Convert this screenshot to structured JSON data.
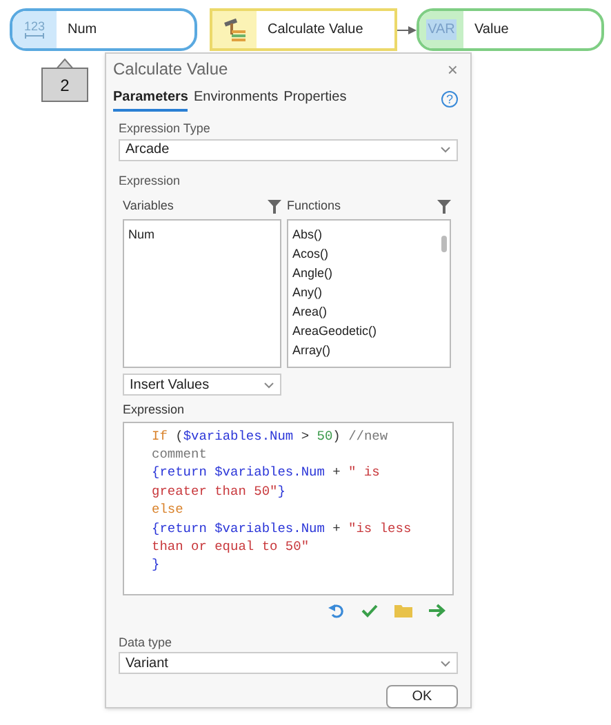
{
  "nodes": [
    {
      "kind": "variable",
      "icon_text": "123",
      "label": "Num"
    },
    {
      "kind": "tool",
      "label": "Calculate Value"
    },
    {
      "kind": "output",
      "icon_text": "VAR",
      "label": "Value"
    }
  ],
  "callout": "2",
  "dialog": {
    "title": "Calculate Value",
    "close": "×",
    "tabs": [
      {
        "label": "Parameters",
        "selected": true
      },
      {
        "label": "Environments",
        "selected": false
      },
      {
        "label": "Properties",
        "selected": false
      }
    ],
    "help": "?",
    "expression_type": {
      "label": "Expression Type",
      "value": "Arcade"
    },
    "expression_section": "Expression",
    "variables": {
      "label": "Variables",
      "items": [
        "Num"
      ]
    },
    "functions": {
      "label": "Functions",
      "items": [
        "Abs()",
        "Acos()",
        "Angle()",
        "Any()",
        "Area()",
        "AreaGeodetic()",
        "Array()"
      ]
    },
    "insert_values": "Insert Values",
    "expression_label": "Expression",
    "code_lines": [
      [
        {
          "text": "If",
          "kind": "keyword"
        },
        {
          "text": " (",
          "kind": "plain"
        },
        {
          "text": "$variables.Num",
          "kind": "var"
        },
        {
          "text": " > ",
          "kind": "plain"
        },
        {
          "text": "50",
          "kind": "number"
        },
        {
          "text": ") ",
          "kind": "plain"
        },
        {
          "text": "//new",
          "kind": "comment"
        }
      ],
      [
        {
          "text": "comment",
          "kind": "comment"
        }
      ],
      [
        {
          "text": "{return $variables.Num",
          "kind": "var"
        },
        {
          "text": " + ",
          "kind": "plain"
        },
        {
          "text": "\" is",
          "kind": "string"
        }
      ],
      [
        {
          "text": "greater than 50\"",
          "kind": "string"
        },
        {
          "text": "}",
          "kind": "var"
        }
      ],
      [
        {
          "text": "else",
          "kind": "keyword"
        }
      ],
      [
        {
          "text": "{return $variables.Num",
          "kind": "var"
        },
        {
          "text": " + ",
          "kind": "plain"
        },
        {
          "text": "\"is less",
          "kind": "string"
        }
      ],
      [
        {
          "text": "than or equal to 50\"",
          "kind": "string"
        }
      ],
      [
        {
          "text": "}",
          "kind": "var"
        }
      ]
    ],
    "data_type": {
      "label": "Data type",
      "value": "Variant"
    },
    "ok": "OK"
  }
}
